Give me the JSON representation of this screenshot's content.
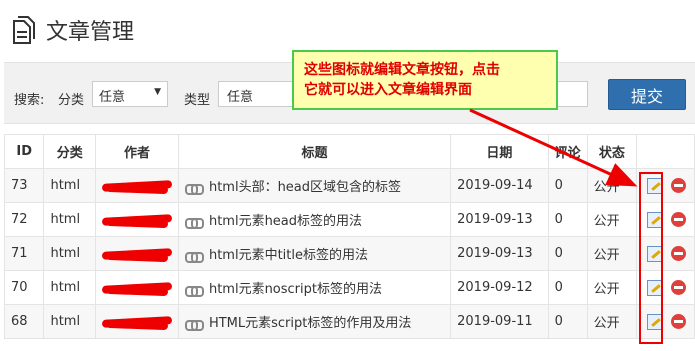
{
  "page": {
    "title": "文章管理",
    "title_icon": "document-icon"
  },
  "filters": {
    "search_label": "搜索:",
    "category_label": "分类",
    "category_value": "任意",
    "type_label": "类型",
    "type_value": "任意",
    "submit_label": "提交"
  },
  "callout": {
    "line1": "这些图标就编辑文章按钮，点击",
    "line2": "它就可以进入文章编辑界面"
  },
  "table": {
    "headers": {
      "id": "ID",
      "category": "分类",
      "author": "作者",
      "title": "标题",
      "date": "日期",
      "comments": "评论",
      "status": "状态"
    },
    "rows": [
      {
        "id": "73",
        "category": "html",
        "title": "html头部：head区域包含的标签",
        "date": "2019-09-14",
        "comments": "0",
        "status": "公开"
      },
      {
        "id": "72",
        "category": "html",
        "title": "html元素head标签的用法",
        "date": "2019-09-13",
        "comments": "0",
        "status": "公开"
      },
      {
        "id": "71",
        "category": "html",
        "title": "html元素中title标签的用法",
        "date": "2019-09-13",
        "comments": "0",
        "status": "公开"
      },
      {
        "id": "70",
        "category": "html",
        "title": "html元素noscript标签的用法",
        "date": "2019-09-12",
        "comments": "0",
        "status": "公开"
      },
      {
        "id": "68",
        "category": "html",
        "title": "HTML元素script标签的作用及用法",
        "date": "2019-09-11",
        "comments": "0",
        "status": "公开"
      }
    ]
  },
  "colors": {
    "accent": "#2f6fae",
    "annotation_red": "#e00000",
    "callout_border": "#4bc94b",
    "callout_bg": "#ffffb0"
  }
}
